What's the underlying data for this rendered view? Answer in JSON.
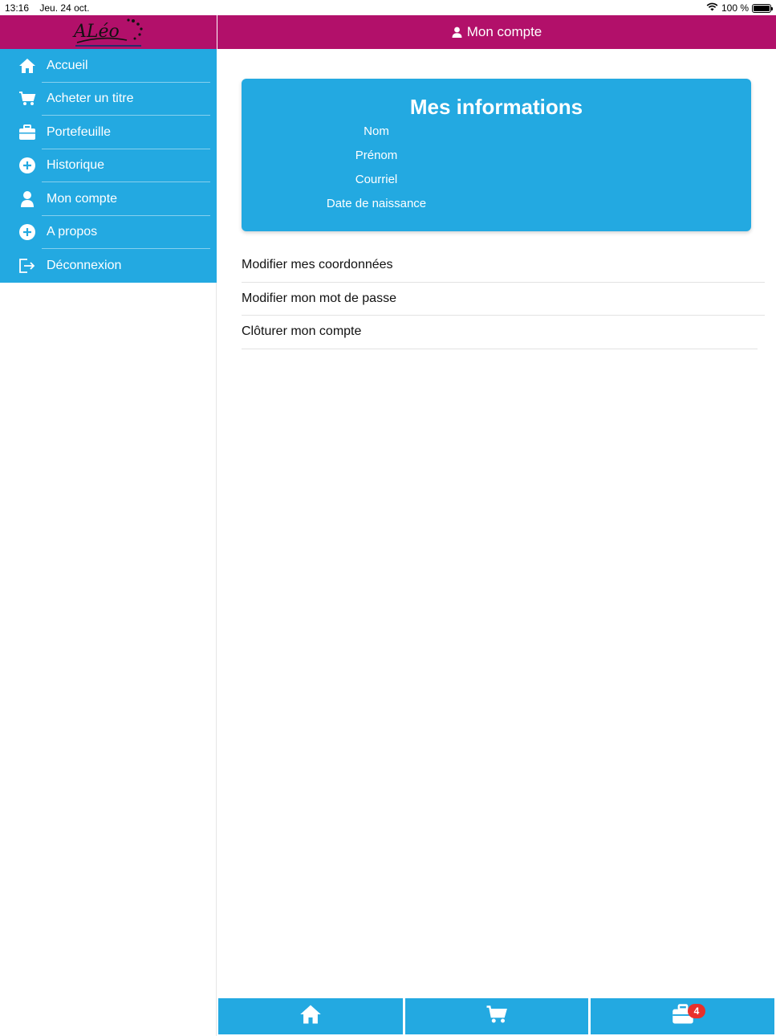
{
  "status_bar": {
    "time": "13:16",
    "date": "Jeu. 24 oct.",
    "battery_text": "100 %",
    "battery_level": 1.0
  },
  "header": {
    "title": "Mon compte",
    "logo_text": "ALéo"
  },
  "sidebar": {
    "items": [
      {
        "label": "Accueil",
        "icon": "home-icon"
      },
      {
        "label": "Acheter un titre",
        "icon": "cart-icon"
      },
      {
        "label": "Portefeuille",
        "icon": "wallet-icon"
      },
      {
        "label": "Historique",
        "icon": "plus-circle-icon"
      },
      {
        "label": "Mon compte",
        "icon": "user-icon"
      },
      {
        "label": "A propos",
        "icon": "plus-circle-icon"
      },
      {
        "label": "Déconnexion",
        "icon": "logout-icon"
      }
    ]
  },
  "info_card": {
    "title": "Mes informations",
    "fields": [
      "Nom",
      "Prénom",
      "Courriel",
      "Date de naissance"
    ]
  },
  "actions": [
    "Modifier mes coordonnées",
    "Modifier mon mot de passe",
    "Clôturer mon compte"
  ],
  "tabbar": {
    "tabs": [
      {
        "icon": "home-icon"
      },
      {
        "icon": "cart-icon"
      },
      {
        "icon": "wallet-icon",
        "badge": "4"
      }
    ]
  },
  "colors": {
    "header": "#b2106a",
    "primary": "#23a9e1",
    "badge": "#e8302b"
  }
}
